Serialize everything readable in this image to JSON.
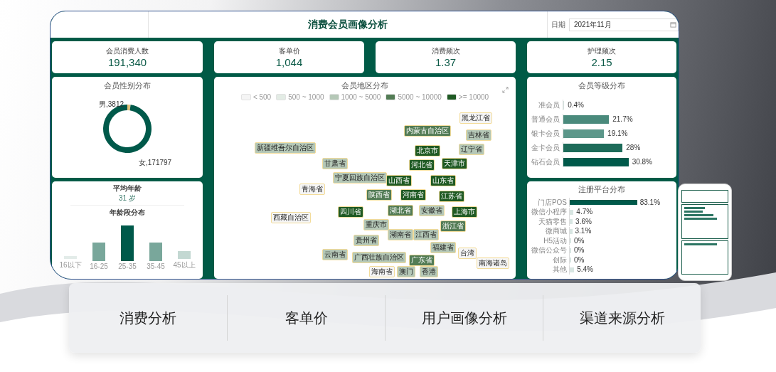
{
  "header": {
    "title": "消费会员画像分析",
    "date_label": "日期",
    "date_value": "2021年11月"
  },
  "kpis": [
    {
      "label": "会员消费人数",
      "value": "191,340"
    },
    {
      "label": "客单价",
      "value": "1,044"
    },
    {
      "label": "消费频次",
      "value": "1.37"
    },
    {
      "label": "护理频次",
      "value": "2.15"
    }
  ],
  "gender": {
    "title": "会员性别分布",
    "chart_data": {
      "type": "donut",
      "categories": [
        "男,3812",
        "女,171797"
      ],
      "values": [
        3812,
        171797
      ]
    }
  },
  "age": {
    "avg_label": "平均年龄",
    "avg_value": "31 岁",
    "title": "年龄段分布",
    "categories": [
      "16以下",
      "16-25",
      "25-35",
      "35-45",
      "45以上"
    ]
  },
  "region": {
    "title": "会员地区分布",
    "legend": [
      {
        "label": "< 500",
        "color": "#f5f5f5"
      },
      {
        "label": "500 ~ 1000",
        "color": "#e3ece5"
      },
      {
        "label": "1000 ~ 5000",
        "color": "#b5c8b7"
      },
      {
        "label": "5000 ~ 10000",
        "color": "#537c55"
      },
      {
        "label": ">= 10000",
        "color": "#1f5a23"
      }
    ],
    "provinces": [
      {
        "name": "黑龙江省",
        "color": "#f5f5f5"
      },
      {
        "name": "吉林省",
        "color": "#b5c8b7"
      },
      {
        "name": "辽宁省",
        "color": "#b5c8b7"
      },
      {
        "name": "内蒙古自治区",
        "color": "#537c55"
      },
      {
        "name": "新疆维吾尔自治区",
        "color": "#b5c8b7"
      },
      {
        "name": "甘肃省",
        "color": "#b5c8b7"
      },
      {
        "name": "青海省",
        "color": "#f5f5f5"
      },
      {
        "name": "西藏自治区",
        "color": "#f5f5f5"
      },
      {
        "name": "宁夏回族自治区",
        "color": "#b5c8b7"
      },
      {
        "name": "北京市",
        "color": "#1f5a23"
      },
      {
        "name": "天津市",
        "color": "#1f5a23"
      },
      {
        "name": "山西省",
        "color": "#1f5a23"
      },
      {
        "name": "河北省",
        "color": "#1f5a23"
      },
      {
        "name": "山东省",
        "color": "#1f5a23"
      },
      {
        "name": "陕西省",
        "color": "#537c55"
      },
      {
        "name": "河南省",
        "color": "#1f5a23"
      },
      {
        "name": "江苏省",
        "color": "#1f5a23"
      },
      {
        "name": "四川省",
        "color": "#1f5a23"
      },
      {
        "name": "重庆市",
        "color": "#b5c8b7"
      },
      {
        "name": "湖北省",
        "color": "#537c55"
      },
      {
        "name": "安徽省",
        "color": "#b5c8b7"
      },
      {
        "name": "上海市",
        "color": "#1f5a23"
      },
      {
        "name": "浙江省",
        "color": "#537c55"
      },
      {
        "name": "湖南省",
        "color": "#b5c8b7"
      },
      {
        "name": "江西省",
        "color": "#b5c8b7"
      },
      {
        "name": "贵州省",
        "color": "#b5c8b7"
      },
      {
        "name": "福建省",
        "color": "#b5c8b7"
      },
      {
        "name": "云南省",
        "color": "#b5c8b7"
      },
      {
        "name": "广西壮族自治区",
        "color": "#b5c8b7"
      },
      {
        "name": "广东省",
        "color": "#537c55"
      },
      {
        "name": "台湾",
        "color": "#f5f5f5"
      },
      {
        "name": "海南省",
        "color": "#f5f5f5"
      },
      {
        "name": "澳门",
        "color": "#b5c8b7"
      },
      {
        "name": "香港",
        "color": "#b5c8b7"
      },
      {
        "name": "南海诸岛",
        "color": "#f5f5f5"
      }
    ]
  },
  "levels": {
    "title": "会员等级分布",
    "items": [
      {
        "name": "准会员",
        "value": "0.4%",
        "level": 0.01,
        "color": "#d5e2de"
      },
      {
        "name": "普通会员",
        "value": "21.7%",
        "level": 0.54,
        "color": "#4a8a7c"
      },
      {
        "name": "银卡会员",
        "value": "19.1%",
        "level": 0.48,
        "color": "#5c978a"
      },
      {
        "name": "金卡会员",
        "value": "28%",
        "level": 0.7,
        "color": "#1d6b59"
      },
      {
        "name": "钻石会员",
        "value": "30.8%",
        "level": 0.77,
        "color": "#00594a"
      }
    ]
  },
  "platforms": {
    "title": "注册平台分布",
    "items": [
      {
        "name": "门店POS",
        "value": "83.1%",
        "level": 0.831,
        "color": "#00594a"
      },
      {
        "name": "微信小程序",
        "value": "4.7%",
        "level": 0.047,
        "color": "#d8e6e2"
      },
      {
        "name": "天猫零售",
        "value": "3.6%",
        "level": 0.036,
        "color": "#d8e6e2"
      },
      {
        "name": "微商城",
        "value": "3.1%",
        "level": 0.031,
        "color": "#d8e6e2"
      },
      {
        "name": "H5活动",
        "value": "0%",
        "level": 0,
        "color": "#d8e6e2"
      },
      {
        "name": "微信公众号",
        "value": "0%",
        "level": 0,
        "color": "#d8e6e2"
      },
      {
        "name": "创际",
        "value": "0%",
        "level": 0,
        "color": "#d8e6e2"
      },
      {
        "name": "其他",
        "value": "5.4%",
        "level": 0.054,
        "color": "#d8e6e2"
      }
    ]
  },
  "tabs": [
    {
      "label": "消费分析"
    },
    {
      "label": "客单价"
    },
    {
      "label": "用户画像分析"
    },
    {
      "label": "渠道来源分析"
    }
  ]
}
